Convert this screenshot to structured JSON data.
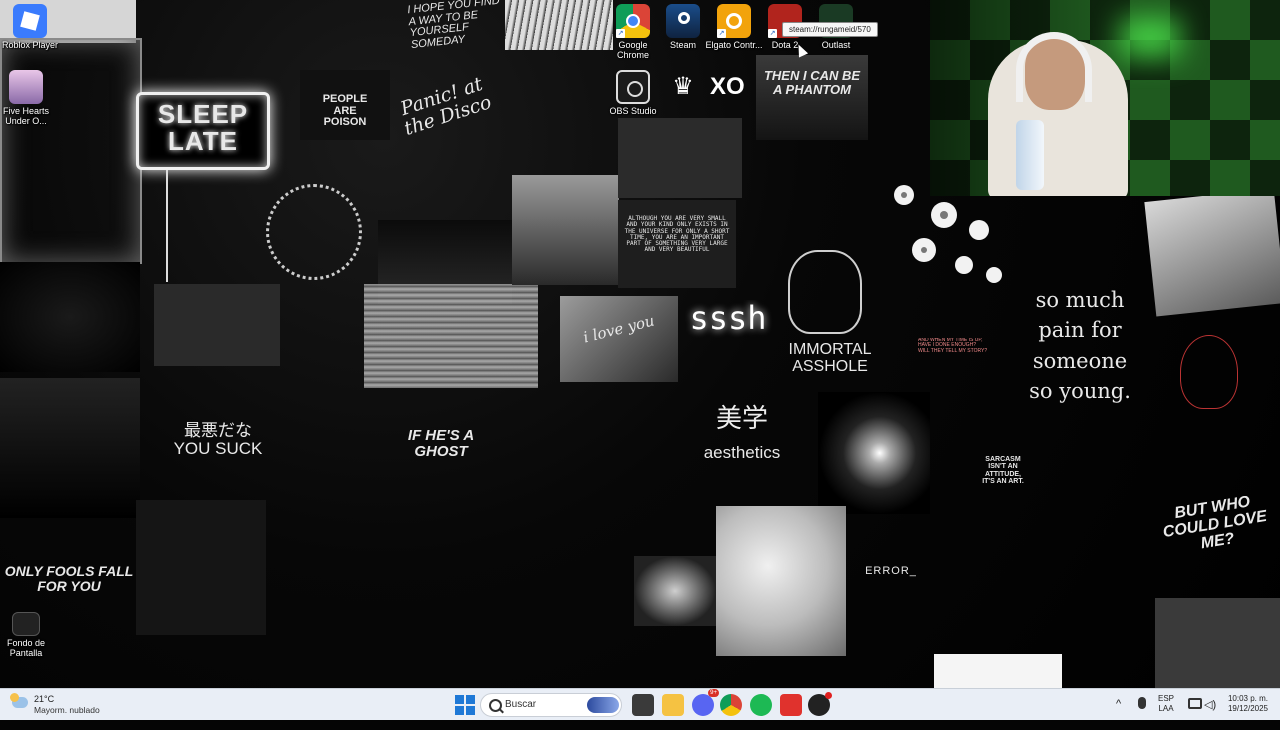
{
  "wallpaper": {
    "sleep_late": "SLEEP\nLATE",
    "people_poison": "PEOPLE\nARE\nPOISON",
    "panic_disco": "Panic! at the Disco",
    "hope_text": "I HOPE YOU FIND A WAY TO BE YOURSELF SOMEDAY",
    "phantom": "THEN I CAN BE\nA PHANTOM",
    "note_text": "ALTHOUGH YOU ARE VERY SMALL AND YOUR KIND ONLY EXISTS IN THE UNIVERSE FOR ONLY A SHORT TIME, YOU ARE AN IMPORTANT PART OF SOMETHING VERY LARGE AND VERY BEAUTIFUL",
    "i_love_you": "i love you",
    "sssh": "sssh",
    "immortal": "IMMORTAL\nASSHOLE",
    "pain": "so much\npain for\nsomeone\nso young.",
    "small_red": "AND WHEN MY TIME IS UP, HAVE I DONE ENOUGH? WILL THEY TELL MY STORY?",
    "bijin_kanji": "美学",
    "aesthetics": "aesthetics",
    "saiaku": "最悪だな\nYOU SUCK",
    "ghost": "IF HE'S A\nGHOST",
    "sarcasm": "SARCASM\nISN'T AN\nATTITUDE,\nIT'S AN ART.",
    "but_who": "BUT WHO\nCOULD LOVE\nME?",
    "only_fools": "ONLY FOOLS FALL\nFOR YOU",
    "error": "ERROR_"
  },
  "desktop_icons": {
    "roblox": "Roblox Player",
    "fivehearts": "Five Hearts Under O...",
    "wallpaper": "Fondo de Pantalla",
    "chrome": "Google Chrome",
    "steam": "Steam",
    "elgato": "Elgato Contr...",
    "dota": "Dota 2",
    "outlast": "Outlast",
    "obs": "OBS Studio",
    "crown_glyph": "♛",
    "xo_glyph": "XO"
  },
  "tooltip": "steam://rungameid/570",
  "taskbar": {
    "weather_temp": "21°C",
    "weather_cond": "Mayorm. nublado",
    "search_placeholder": "Buscar",
    "discord_badge": "9+",
    "chevron": "^",
    "lang_line1": "ESP",
    "lang_line2": "LAA",
    "volume_glyph": "◁)",
    "time": "10:03 p. m.",
    "date": "19/12/2025"
  },
  "colors": {
    "taskbar_bg": "#e9eef6",
    "accent": "#1e78d6",
    "webcam_green": "#4ae04a"
  }
}
